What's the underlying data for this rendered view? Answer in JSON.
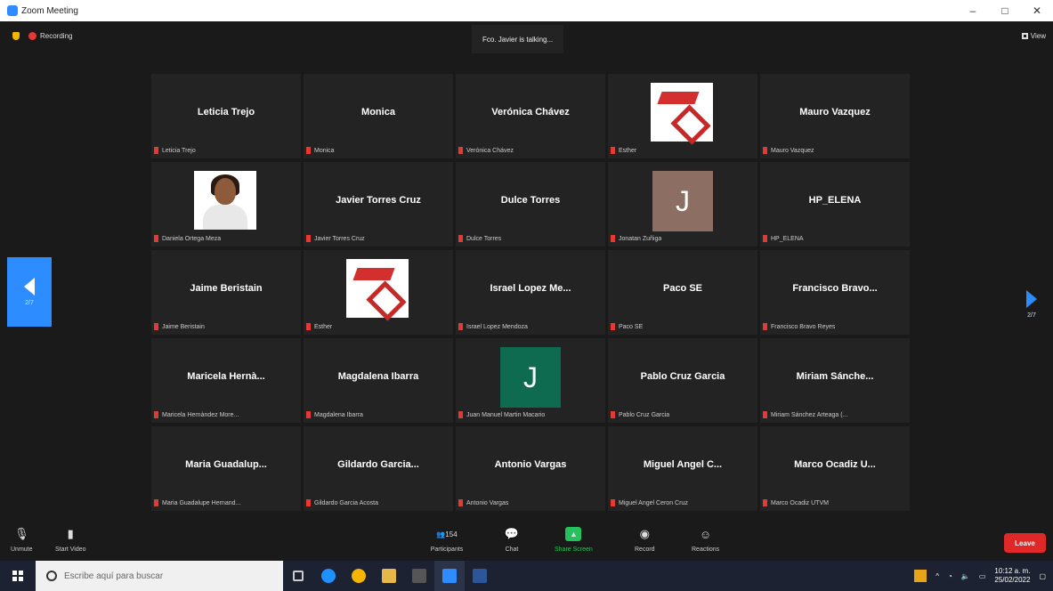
{
  "window": {
    "title": "Zoom Meeting",
    "controls": [
      "–",
      "□",
      "✕"
    ]
  },
  "meeting": {
    "recording_label": "Recording",
    "talking": "Fco. Javier is talking...",
    "view_label": "View",
    "page_left": "2/7",
    "page_right": "2/7"
  },
  "tiles": [
    {
      "big": "Leticia Trejo",
      "label": "Leticia Trejo",
      "type": "name"
    },
    {
      "big": "Monica",
      "label": "Monica",
      "type": "name"
    },
    {
      "big": "Verónica Chávez",
      "label": "Verónica Chávez",
      "type": "name"
    },
    {
      "big": "",
      "label": "Esther",
      "type": "logo"
    },
    {
      "big": "Mauro Vazquez",
      "label": "Mauro Vazquez",
      "type": "name"
    },
    {
      "big": "",
      "label": "Daniela Ortega Meza",
      "type": "photo"
    },
    {
      "big": "Javier Torres Cruz",
      "label": "Javier Torres Cruz",
      "type": "name"
    },
    {
      "big": "Dulce Torres",
      "label": "Dulce Torres",
      "type": "name"
    },
    {
      "big": "J",
      "label": "Jonatan Zuñiga",
      "type": "avatar",
      "color": "#8c6e62"
    },
    {
      "big": "HP_ELENA",
      "label": "HP_ELENA",
      "type": "name"
    },
    {
      "big": "Jaime Beristain",
      "label": "Jaime Beristain",
      "type": "name"
    },
    {
      "big": "",
      "label": "Esther",
      "type": "logo"
    },
    {
      "big": "Israel Lopez Me...",
      "label": "Israel Lopez Mendoza",
      "type": "name"
    },
    {
      "big": "Paco SE",
      "label": "Paco SE",
      "type": "name"
    },
    {
      "big": "Francisco  Bravo...",
      "label": "Francisco Bravo Reyes",
      "type": "name"
    },
    {
      "big": "Maricela  Hernà...",
      "label": "Maricela Hernàndez More...",
      "type": "name"
    },
    {
      "big": "Magdalena Ibarra",
      "label": "Magdalena Ibarra",
      "type": "name"
    },
    {
      "big": "J",
      "label": "Juan Manuel Martin Macario",
      "type": "avatar",
      "color": "#0f6b50"
    },
    {
      "big": "Pablo Cruz Garcia",
      "label": "Pablo Cruz Garcia",
      "type": "name"
    },
    {
      "big": "Miriam   Sánche...",
      "label": "Miriam  Sánchez Arteaga (...",
      "type": "name"
    },
    {
      "big": "Maria  Guadalup...",
      "label": "Maria Guadalupe Hernand...",
      "type": "name"
    },
    {
      "big": "Gildardo  Garcia...",
      "label": "Gildardo Garcia Acosta",
      "type": "name"
    },
    {
      "big": "Antonio Vargas",
      "label": "Antonio Vargas",
      "type": "name"
    },
    {
      "big": "Miguel Angel C...",
      "label": "Miguel Angel Ceron Cruz",
      "type": "name"
    },
    {
      "big": "Marco  Ocadiz U...",
      "label": "Marco Ocadiz UTVM",
      "type": "name"
    }
  ],
  "toolbar": {
    "unmute": "Unmute",
    "start_video": "Start Video",
    "participants": "Participants",
    "participants_count": "154",
    "chat": "Chat",
    "share_screen": "Share Screen",
    "record": "Record",
    "reactions": "Reactions",
    "leave": "Leave"
  },
  "taskbar": {
    "search_placeholder": "Escribe aquí para buscar",
    "time": "10:12 a. m.",
    "date": "25/02/2022"
  },
  "colors": {
    "accent": "#2d8cff",
    "leave": "#e02828",
    "muted_mic": "#e53935",
    "share_green": "#25c15d"
  }
}
